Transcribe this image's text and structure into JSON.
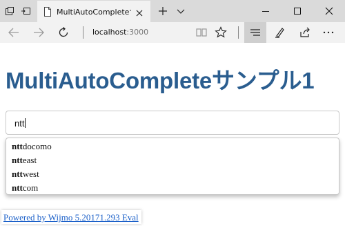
{
  "browser": {
    "tab_title": "MultiAutoCompleteサン",
    "url_host": "localhost",
    "url_port": ":3000",
    "icons": [
      "tab-overview-icon",
      "set-aside-tabs-icon",
      "page-icon",
      "close-icon",
      "new-tab-icon",
      "tab-list-chevron-icon",
      "minimize-icon",
      "maximize-icon",
      "window-close-icon",
      "back-icon",
      "forward-icon",
      "refresh-icon",
      "reading-view-icon",
      "favorite-star-icon",
      "hub-icon",
      "web-note-icon",
      "share-icon",
      "more-icon"
    ]
  },
  "page": {
    "heading": "MultiAutoCompleteサンプル1",
    "input_value": "ntt",
    "suggestions": [
      {
        "match": "ntt",
        "rest": "docomo"
      },
      {
        "match": "ntt",
        "rest": "east"
      },
      {
        "match": "ntt",
        "rest": "west"
      },
      {
        "match": "ntt",
        "rest": "com"
      }
    ],
    "footer_link": "Powered by Wijmo 5.20171.293 Eval"
  },
  "colors": {
    "heading": "#2a5d8f",
    "tabstrip": "#dadada",
    "toolbar": "#f2f2f2",
    "link": "#1a5fc8"
  }
}
